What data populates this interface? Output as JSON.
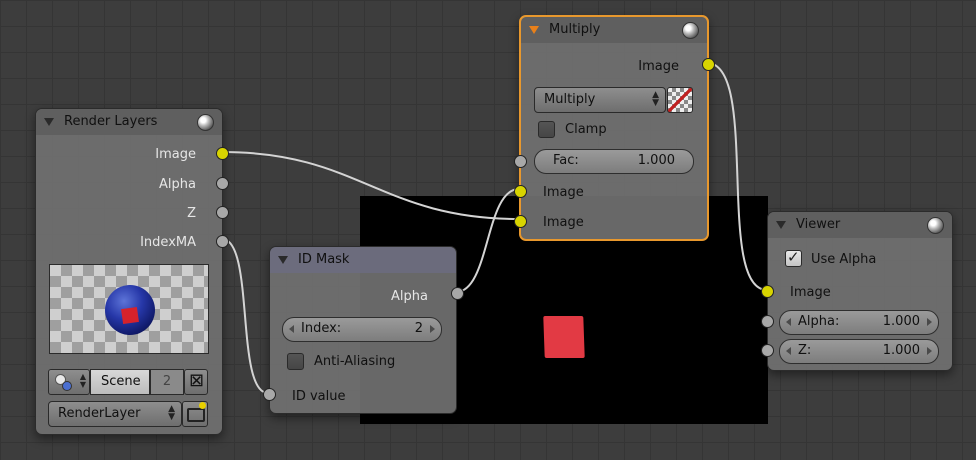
{
  "render_layers": {
    "title": "Render Layers",
    "outputs": [
      "Image",
      "Alpha",
      "Z",
      "IndexMA"
    ],
    "scene_label": "Scene",
    "scene_users": "2",
    "layer_label": "RenderLayer"
  },
  "id_mask": {
    "title": "ID Mask",
    "output": "Alpha",
    "index_label": "Index:",
    "index_value": "2",
    "anti_aliasing_label": "Anti-Aliasing",
    "anti_aliasing_checked": false,
    "input": "ID value"
  },
  "multiply": {
    "title": "Multiply",
    "output": "Image",
    "blend_mode": "Multiply",
    "clamp_label": "Clamp",
    "clamp_checked": false,
    "fac_label": "Fac:",
    "fac_value": "1.000",
    "inputs": [
      "Image",
      "Image"
    ]
  },
  "viewer": {
    "title": "Viewer",
    "use_alpha_label": "Use Alpha",
    "use_alpha_checked": true,
    "inputs": [
      "Image"
    ],
    "alpha_label": "Alpha:",
    "alpha_value": "1.000",
    "z_label": "Z:",
    "z_value": "1.000"
  },
  "colors": {
    "grid_bg": "#3d3d3d",
    "node_body": "#707070",
    "active_border": "#e8982d",
    "socket_image": "#d8d400",
    "socket_value": "#a8a8a8",
    "preview_red": "#e23a44"
  }
}
